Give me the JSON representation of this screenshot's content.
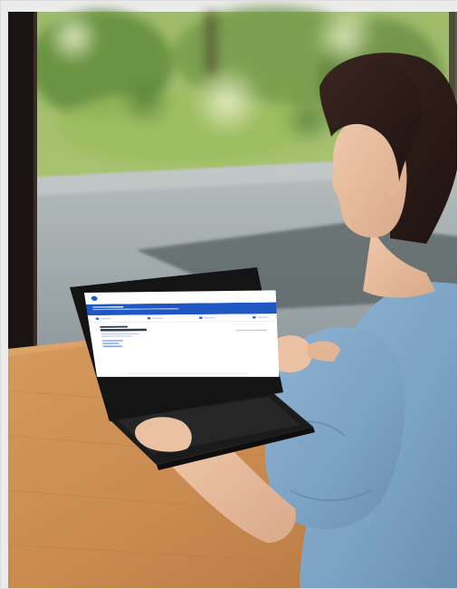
{
  "scene": {
    "subject": "woman",
    "device": "laptop",
    "colors": {
      "shirt": "#7fa6c8",
      "hair": "#2a1b16",
      "table": "#c4854c",
      "laptop": "#161616",
      "window_frame": "#1a1512",
      "floor": "#9aa3a5",
      "garden": "#8fb05a"
    }
  },
  "laptop_ui": {
    "brand_color": "#1e56c2",
    "icons": [
      "logo-mark-icon",
      "tab-icon",
      "tab-icon",
      "tab-icon",
      "tab-icon"
    ]
  }
}
